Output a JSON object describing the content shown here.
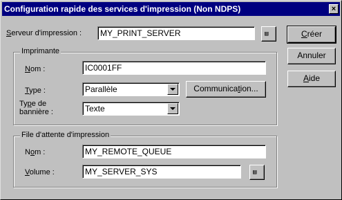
{
  "window": {
    "title": "Configuration rapide des services d'impression (Non NDPS)",
    "close_glyph": "×"
  },
  "server": {
    "label_prefix": "S",
    "label_rest": "erveur d'impression :",
    "value": "MY_PRINT_SERVER"
  },
  "buttons": {
    "create": "Créer",
    "create_mnemonic": "C",
    "create_rest": "réer",
    "cancel": "Annuler",
    "help_mnemonic": "A",
    "help_rest": "ide"
  },
  "printer_group": {
    "title": "Imprimante",
    "name_label_mnemonic": "N",
    "name_label_rest": "om :",
    "name_value": "IC0001FF",
    "type_label_mnemonic": "T",
    "type_label_rest": "ype :",
    "type_value": "Parallèle",
    "communication_button_prefix": "Communica",
    "communication_button_mnemonic": "t",
    "communication_button_suffix": "ion...",
    "banner_label_line1_prefix": "Ty",
    "banner_label_line1_mnemonic": "p",
    "banner_label_line1_suffix": "e de",
    "banner_label_line2": "bannière :",
    "banner_value": "Texte"
  },
  "queue_group": {
    "title": "File d'attente d'impression",
    "name_label_prefix": "N",
    "name_label_mnemonic": "o",
    "name_label_rest": "m :",
    "name_value": "MY_REMOTE_QUEUE",
    "volume_label_mnemonic": "V",
    "volume_label_rest": "olume :",
    "volume_value": "MY_SERVER_SYS"
  },
  "icons": {
    "browse": "browse-tree-icon",
    "dropdown": "chevron-down-icon",
    "close": "close-icon"
  }
}
